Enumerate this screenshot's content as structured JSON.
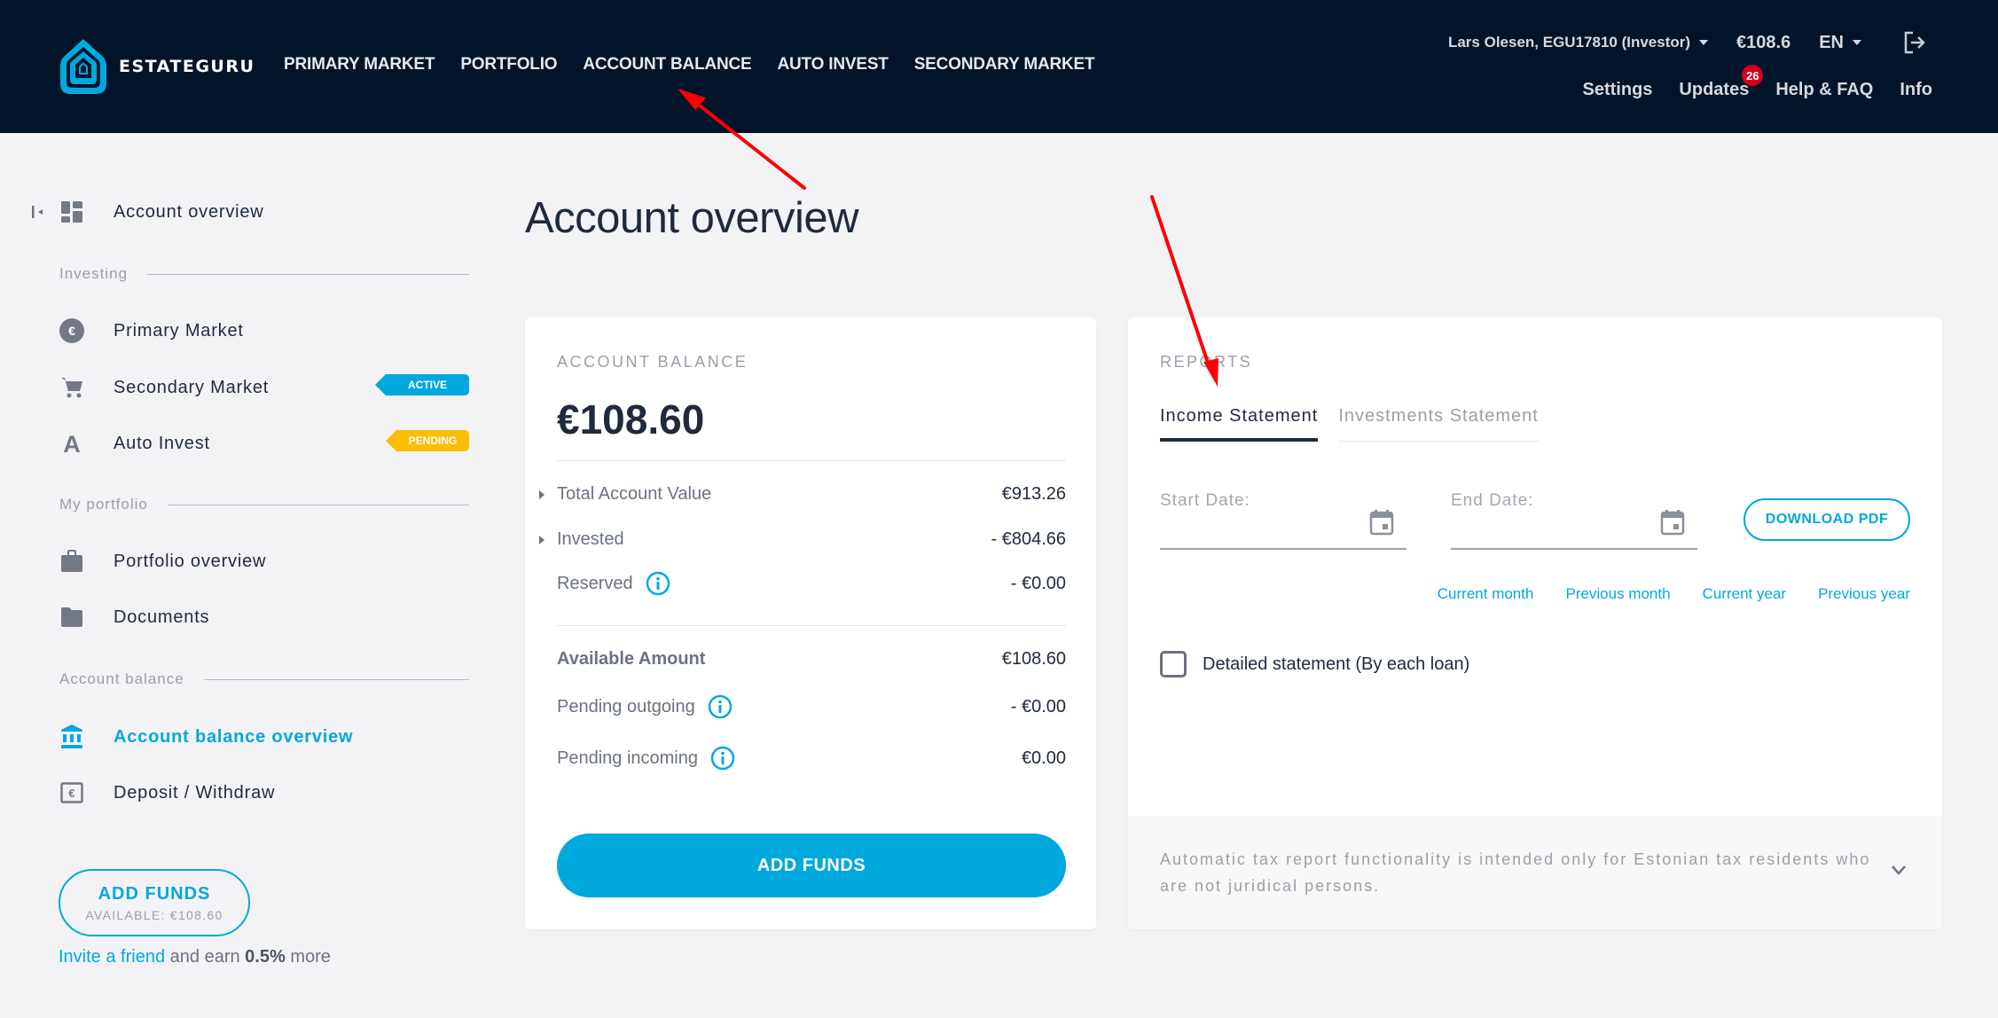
{
  "header": {
    "brand": "ESTATEGURU",
    "nav": [
      "PRIMARY MARKET",
      "PORTFOLIO",
      "ACCOUNT BALANCE",
      "AUTO INVEST",
      "SECONDARY MARKET"
    ],
    "user": "Lars Olesen, EGU17810 (Investor)",
    "balance": "€108.6",
    "language": "EN",
    "subnav": {
      "settings": "Settings",
      "updates": "Updates",
      "updates_count": "26",
      "help": "Help & FAQ",
      "info": "Info"
    },
    "icons": {
      "logo": "estateguru-house-logo-icon",
      "logout": "logout-icon",
      "user_dropdown": "caret-down-icon",
      "lang_dropdown": "caret-down-icon"
    }
  },
  "sidebar": {
    "top_item": {
      "label": "Account overview",
      "icon": "dashboard-icon"
    },
    "sections": [
      {
        "label": "Investing",
        "items": [
          {
            "label": "Primary Market",
            "icon": "euro-circle-icon"
          },
          {
            "label": "Secondary Market",
            "icon": "cart-icon",
            "tag": "ACTIVE"
          },
          {
            "label": "Auto Invest",
            "icon": "letter-a-icon",
            "tag": "PENDING"
          }
        ]
      },
      {
        "label": "My portfolio",
        "items": [
          {
            "label": "Portfolio overview",
            "icon": "briefcase-icon"
          },
          {
            "label": "Documents",
            "icon": "folder-icon"
          }
        ]
      },
      {
        "label": "Account balance",
        "items": [
          {
            "label": "Account balance overview",
            "icon": "bank-icon",
            "active": true
          },
          {
            "label": "Deposit / Withdraw",
            "icon": "euro-note-icon"
          }
        ]
      }
    ],
    "add_funds": {
      "label": "ADD FUNDS",
      "available": "AVAILABLE: €108.60"
    },
    "invite": {
      "link": "Invite a friend",
      "text1": "and earn",
      "bonus": "0.5%",
      "text2": "more"
    }
  },
  "main": {
    "title": "Account overview",
    "balance_card": {
      "label": "ACCOUNT BALANCE",
      "amount": "€108.60",
      "rows": [
        {
          "name": "Total Account Value",
          "value": "€913.26",
          "expandable": true
        },
        {
          "name": "Invested",
          "value": "- €804.66",
          "expandable": true
        },
        {
          "name": "Reserved",
          "value": "- €0.00",
          "info": true
        },
        {
          "name": "Available Amount",
          "value": "€108.60",
          "bold": true
        },
        {
          "name": "Pending outgoing",
          "value": "- €0.00",
          "info": true
        },
        {
          "name": "Pending incoming",
          "value": "€0.00",
          "info": true
        }
      ],
      "button": "ADD FUNDS"
    },
    "reports_card": {
      "label": "REPORTS",
      "tabs": [
        {
          "label": "Income Statement",
          "active": true
        },
        {
          "label": "Investments Statement",
          "active": false
        }
      ],
      "start_date": {
        "placeholder": "Start Date:",
        "value": ""
      },
      "end_date": {
        "placeholder": "End Date:",
        "value": ""
      },
      "download": "DOWNLOAD PDF",
      "quick_ranges": [
        "Current month",
        "Previous month",
        "Current year",
        "Previous year"
      ],
      "detailed_checkbox": {
        "label": "Detailed statement (By each loan)",
        "checked": false
      },
      "tax_note": "Automatic tax report functionality is intended only for Estonian tax residents who are not juridical persons."
    }
  },
  "colors": {
    "header_bg": "#01142a",
    "accent": "#00a8de",
    "pending": "#fbbd08",
    "badge": "#d0021b",
    "annotation": "#ff0000"
  }
}
